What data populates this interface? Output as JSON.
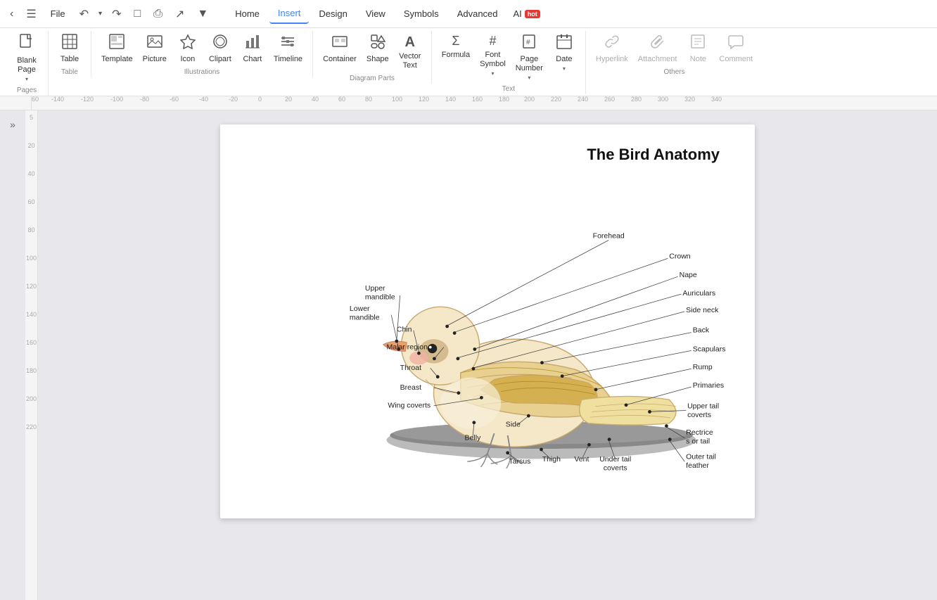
{
  "menubar": {
    "file_label": "File",
    "tabs": [
      {
        "label": "Home",
        "active": false
      },
      {
        "label": "Insert",
        "active": true
      },
      {
        "label": "Design",
        "active": false
      },
      {
        "label": "View",
        "active": false
      },
      {
        "label": "Symbols",
        "active": false
      },
      {
        "label": "Advanced",
        "active": false
      },
      {
        "label": "AI",
        "active": false,
        "badge": "hot"
      }
    ]
  },
  "ribbon": {
    "groups": [
      {
        "label": "Pages",
        "items": [
          {
            "id": "blank-page",
            "label": "Blank\nPage",
            "icon": "☐",
            "has_arrow": true
          }
        ]
      },
      {
        "label": "Table",
        "items": [
          {
            "id": "table",
            "label": "Table",
            "icon": "⊞"
          }
        ]
      },
      {
        "label": "Illustrations",
        "items": [
          {
            "id": "template",
            "label": "Template",
            "icon": "⊡"
          },
          {
            "id": "picture",
            "label": "Picture",
            "icon": "🖼"
          },
          {
            "id": "icon",
            "label": "Icon",
            "icon": "⬡"
          },
          {
            "id": "clipart",
            "label": "Clipart",
            "icon": "✂"
          },
          {
            "id": "chart",
            "label": "Chart",
            "icon": "◕"
          },
          {
            "id": "timeline",
            "label": "Timeline",
            "icon": "≡"
          }
        ]
      },
      {
        "label": "Diagram Parts",
        "items": [
          {
            "id": "container",
            "label": "Container",
            "icon": "▭"
          },
          {
            "id": "shape",
            "label": "Shape",
            "icon": "◇"
          },
          {
            "id": "vector-text",
            "label": "Vector\nText",
            "icon": "A"
          }
        ]
      },
      {
        "label": "Text",
        "items": [
          {
            "id": "formula",
            "label": "Formula",
            "icon": "Σ"
          },
          {
            "id": "font-symbol",
            "label": "Font\nSymbol",
            "icon": "#",
            "has_arrow": true
          },
          {
            "id": "page-number",
            "label": "Page\nNumber",
            "icon": "⊞",
            "has_arrow": true
          },
          {
            "id": "date",
            "label": "Date",
            "icon": "📅",
            "has_arrow": true
          }
        ]
      },
      {
        "label": "Others",
        "items": [
          {
            "id": "hyperlink",
            "label": "Hyperlink",
            "icon": "🔗",
            "disabled": true
          },
          {
            "id": "attachment",
            "label": "Attachment",
            "icon": "📎",
            "disabled": true
          },
          {
            "id": "note",
            "label": "Note",
            "icon": "📝",
            "disabled": true
          },
          {
            "id": "comment",
            "label": "Comment",
            "icon": "💬",
            "disabled": true
          }
        ]
      }
    ]
  },
  "ruler": {
    "marks": [
      "-140",
      "-120",
      "-100",
      "-80",
      "-60",
      "-40",
      "-20",
      "0",
      "20",
      "40",
      "60",
      "80",
      "100",
      "120",
      "140",
      "160",
      "180",
      "200",
      "220",
      "240",
      "260",
      "280",
      "300",
      "320",
      "340"
    ]
  },
  "diagram": {
    "title": "The Bird Anatomy",
    "labels": [
      "Forehead",
      "Crown",
      "Nape",
      "Auriculars",
      "Side neck",
      "Back",
      "Scapulars",
      "Rump",
      "Primaries",
      "Upper tail coverts",
      "Rectrices or tail",
      "Outer tail feather",
      "Under tail coverts",
      "Vent",
      "Thigh",
      "Tarsus",
      "Belly",
      "Side",
      "Wing coverts",
      "Breast",
      "Throat",
      "Malar region",
      "Chin",
      "Lower mandible",
      "Upper mandible"
    ]
  }
}
